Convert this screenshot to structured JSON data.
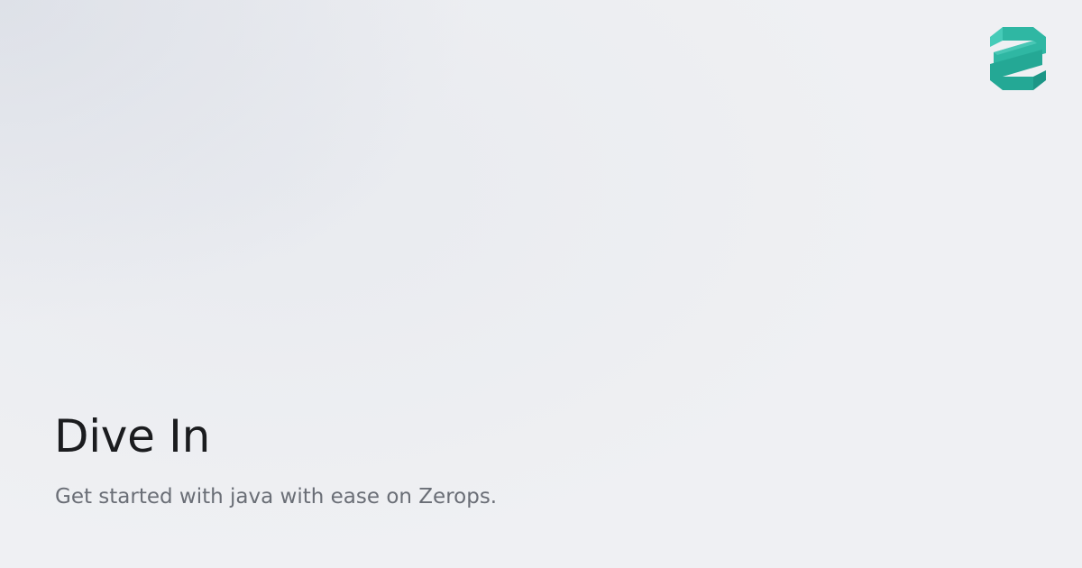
{
  "brand": {
    "logo_icon": "zerops-logo-icon",
    "accent_color": "#2cb3a0",
    "accent_light": "#46cbb8",
    "accent_dark": "#1c9686"
  },
  "hero": {
    "title": "Dive In",
    "subtitle": "Get started with java with ease on Zerops."
  },
  "colors": {
    "background": "#eff0f3",
    "title": "#1b1c1f",
    "subtitle": "#6a6e76"
  }
}
